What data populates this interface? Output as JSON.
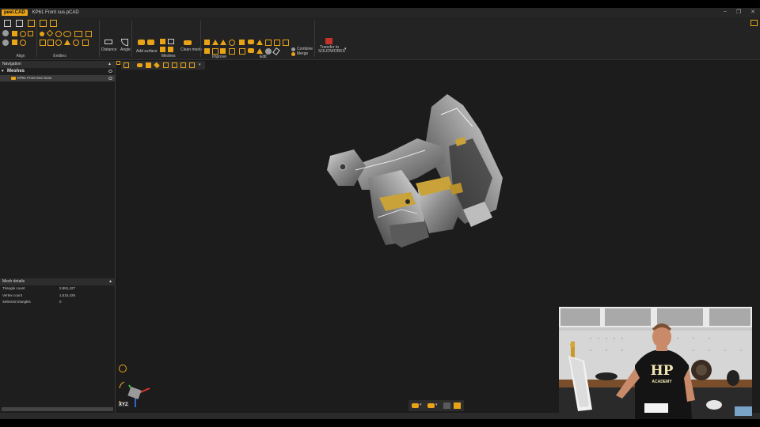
{
  "app": {
    "brand": "peel.CAD",
    "doc_title": "KP61 Front sus.pCAD"
  },
  "window_controls": {
    "minimize": "–",
    "restore": "❐",
    "close": "✕"
  },
  "ribbon": {
    "groups": [
      {
        "label": "Align"
      },
      {
        "label": "Entities"
      },
      {
        "label": "Distance"
      },
      {
        "label": "Angle"
      },
      {
        "label": "Add surface"
      },
      {
        "label": "Meshes"
      },
      {
        "label": "Clean mesh"
      },
      {
        "label": "Improve"
      },
      {
        "label": "Edit"
      }
    ],
    "small_buttons": [
      "Combine",
      "Merge"
    ],
    "transfer_label": "Transfer to SOLIDWORKS"
  },
  "navigation": {
    "header": "Navigation",
    "tree_root": "Meshes",
    "items": [
      {
        "label": "KP61 Front Sus Scan"
      }
    ]
  },
  "mesh_details": {
    "header": "Mesh details",
    "rows": [
      {
        "label": "Triangle count",
        "value": "2,881,427"
      },
      {
        "label": "Vertex count",
        "value": "1,515,426"
      },
      {
        "label": "Selected triangles",
        "value": "0"
      }
    ]
  },
  "axis_gizmo": {
    "label": "XYZ"
  },
  "webcam": {
    "shirt_text": "HP",
    "shirt_subtext": "ACADEMY"
  },
  "colors": {
    "accent": "#e8a317",
    "background": "#1c1c1c",
    "panel": "#1e1e1e"
  },
  "icons": [
    "home-icon",
    "file-icon",
    "save-icon",
    "eye-icon",
    "gizmo-icon",
    "scissors-icon",
    "ruler-icon",
    "angle-icon"
  ]
}
